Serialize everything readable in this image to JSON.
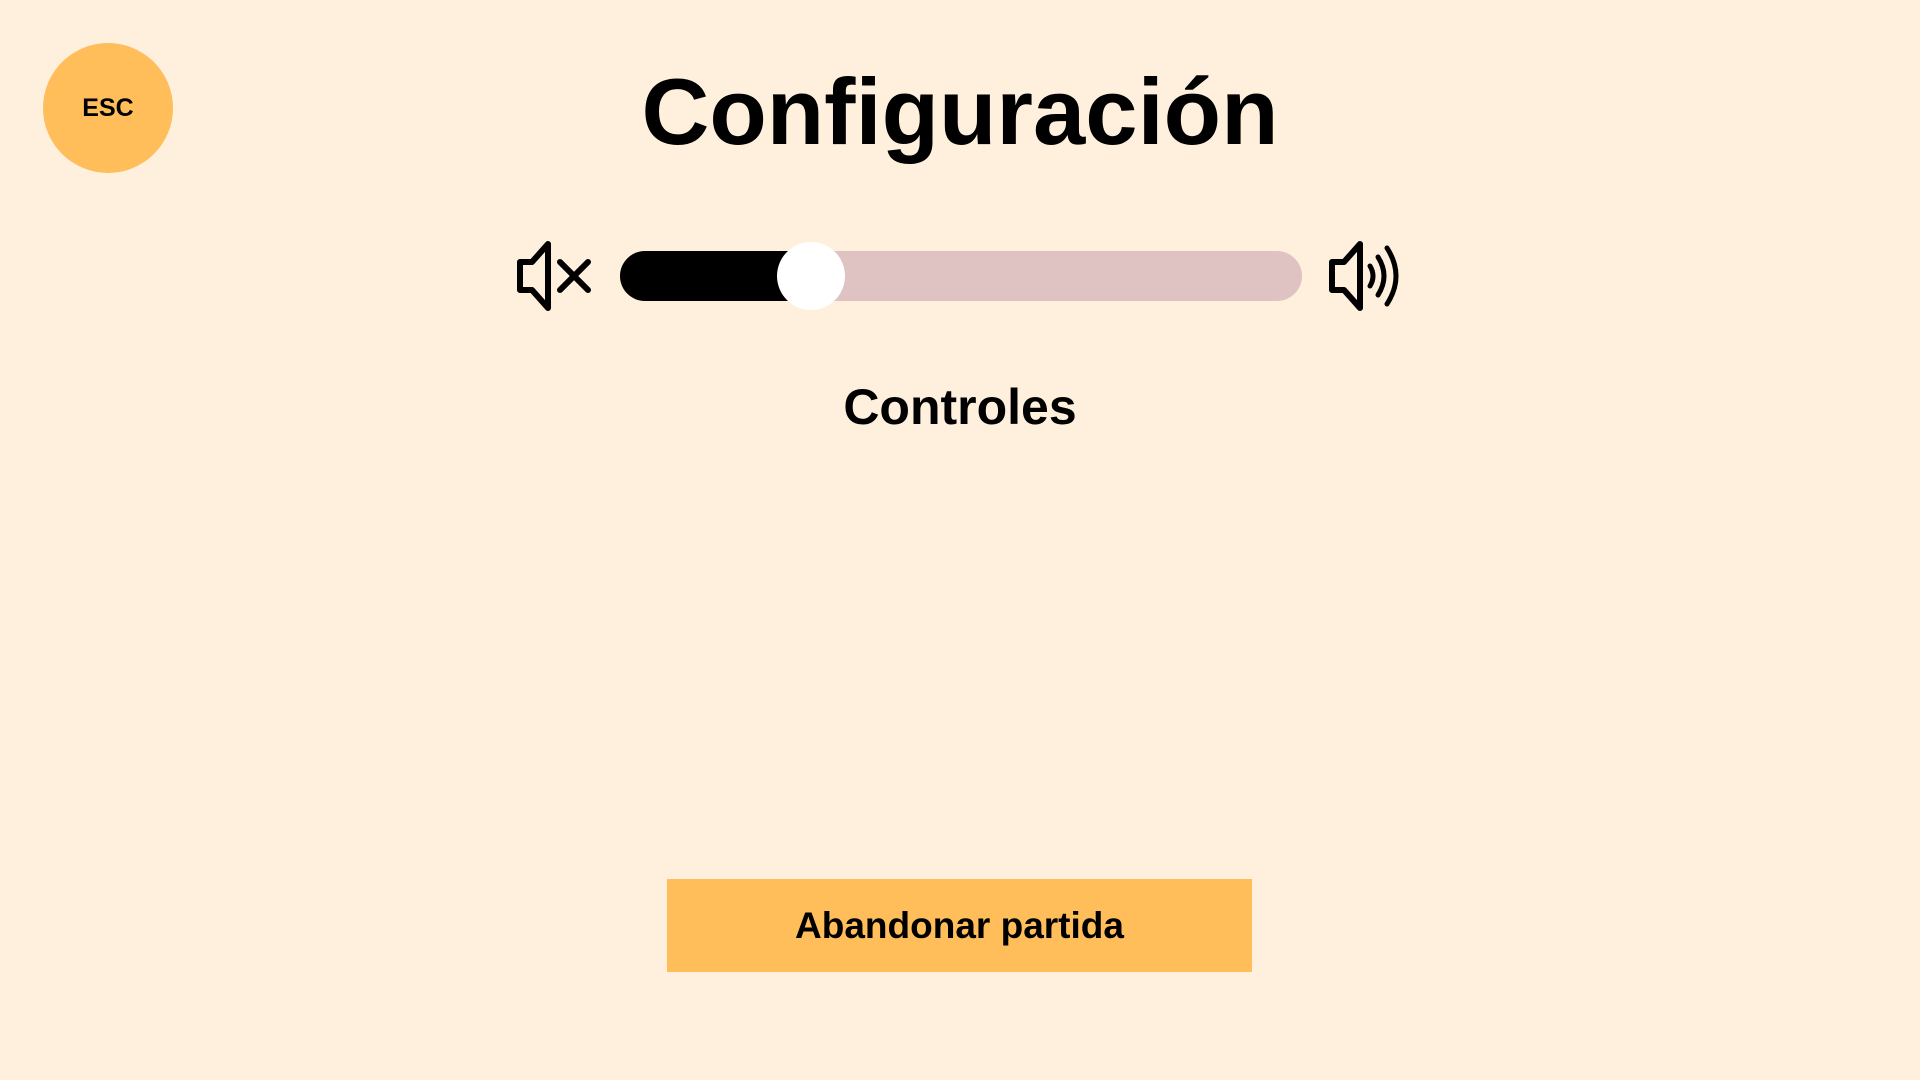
{
  "colors": {
    "background": "#FFF0DE",
    "accent": "#FFBE5A",
    "slider_fill": "#000000",
    "slider_track": "#DFC2C2",
    "text": "#000000"
  },
  "esc_button": {
    "label": "ESC"
  },
  "title": "Configuración",
  "volume": {
    "level": 0.28,
    "min_icon": "speaker-mute-icon",
    "max_icon": "speaker-volume-high-icon"
  },
  "controls": {
    "heading": "Controles"
  },
  "abandon_button": {
    "label": "Abandonar partida"
  }
}
